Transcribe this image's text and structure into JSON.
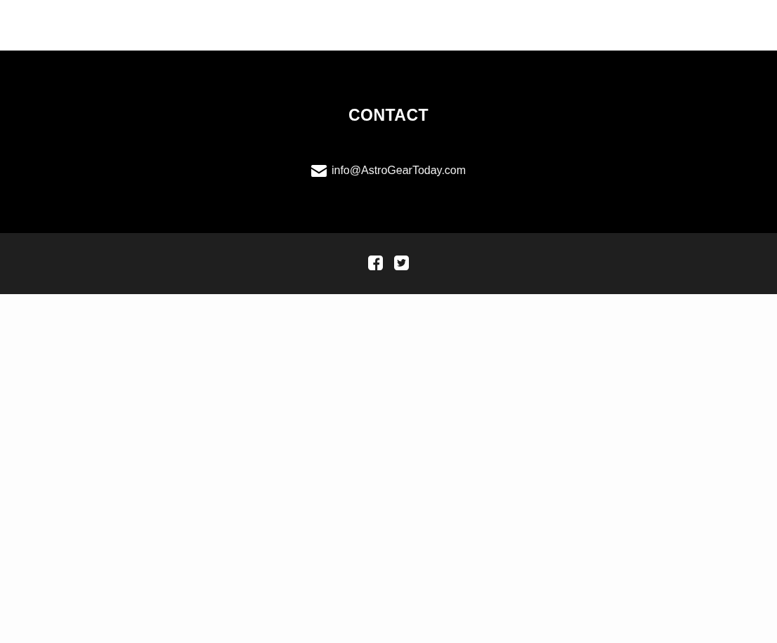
{
  "contact": {
    "heading": "CONTACT",
    "email": "info@AstroGearToday.com"
  },
  "social_links": [
    {
      "kind": "facebook"
    },
    {
      "kind": "twitter"
    }
  ]
}
